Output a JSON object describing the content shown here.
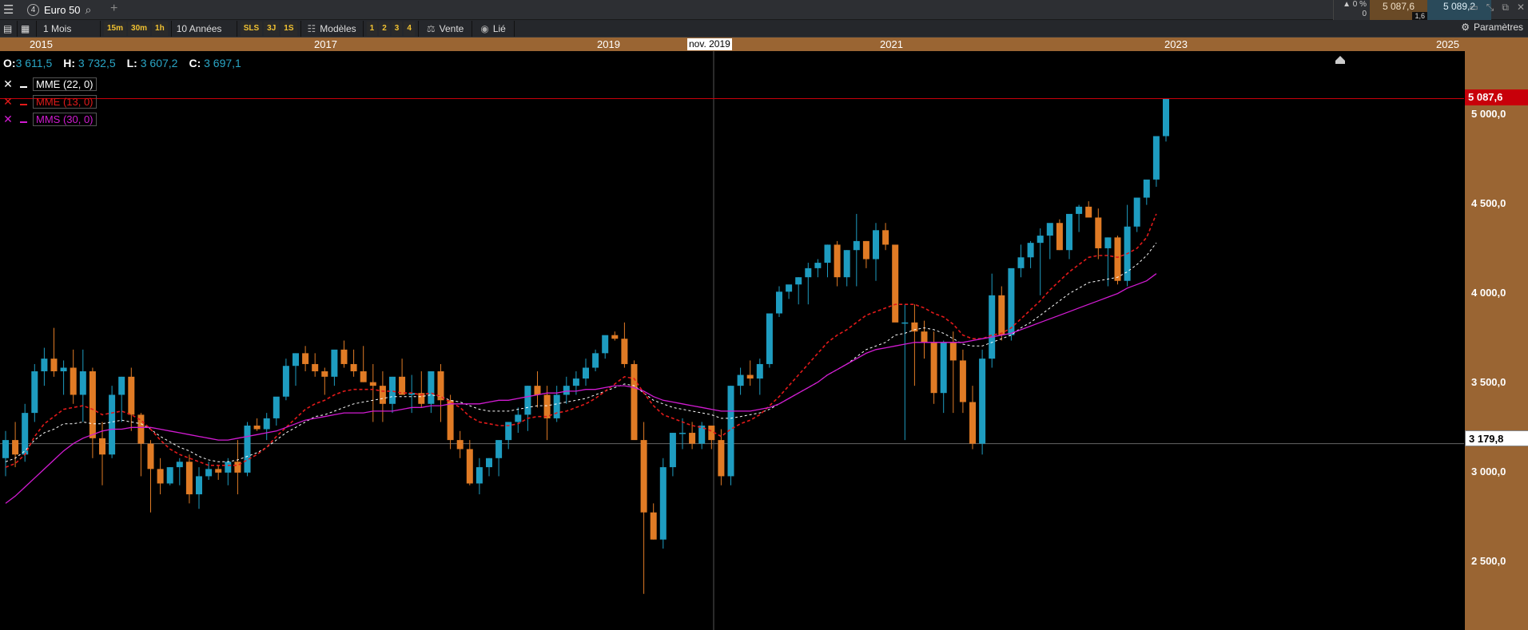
{
  "titlebar": {
    "tab_number": "4",
    "instrument": "Euro 50",
    "change_pct": "0 %",
    "change_val": "0",
    "bid": "5 087,6",
    "ask": "5 089,2",
    "spread": "1,6"
  },
  "toolbar": {
    "period": "1 Mois",
    "intervals": [
      "15m",
      "30m",
      "1h"
    ],
    "range": "10 Années",
    "quick": [
      "SLS",
      "3J",
      "1S"
    ],
    "templates": "Modèles",
    "layouts": [
      "1",
      "2",
      "3",
      "4"
    ],
    "sell": "Vente",
    "linked": "Lié",
    "settings": "Paramètres"
  },
  "datebar": {
    "years": [
      "2015",
      "2017",
      "2019",
      "2021",
      "2023",
      "2025"
    ],
    "cursor_date": "nov. 2019"
  },
  "ohlc": {
    "o_label": "O:",
    "o": "3 611,5",
    "h_label": "H:",
    "h": "3 732,5",
    "l_label": "L:",
    "l": "3 607,2",
    "c_label": "C:",
    "c": "3 697,1"
  },
  "indicators": [
    {
      "name": "MME (22, 0)",
      "color": "#ffffff"
    },
    {
      "name": "MME (13, 0)",
      "color": "#e31a1a"
    },
    {
      "name": "MMS (30, 0)",
      "color": "#d21bd2"
    }
  ],
  "price_axis": {
    "ticks": [
      "5 000,0",
      "4 500,0",
      "4 000,0",
      "3 500,0",
      "3 000,0",
      "2 500,0"
    ],
    "last_price": "5 087,6",
    "cursor_price": "3 179,8"
  },
  "colors": {
    "up": "#1e9cc0",
    "down": "#e07b25",
    "axis_bg": "#9a6533",
    "last_badge": "#c8000a"
  },
  "chart_data": {
    "type": "candlestick",
    "ylim": [
      2150,
      5350
    ],
    "candles": [
      [
        3100,
        3250,
        3000,
        3200
      ],
      [
        3200,
        3300,
        3050,
        3120
      ],
      [
        3120,
        3400,
        3080,
        3350
      ],
      [
        3350,
        3620,
        3300,
        3580
      ],
      [
        3580,
        3710,
        3500,
        3650
      ],
      [
        3650,
        3820,
        3550,
        3580
      ],
      [
        3580,
        3640,
        3450,
        3600
      ],
      [
        3600,
        3700,
        3400,
        3450
      ],
      [
        3450,
        3700,
        3300,
        3580
      ],
      [
        3580,
        3600,
        3100,
        3210
      ],
      [
        3210,
        3300,
        2950,
        3120
      ],
      [
        3120,
        3500,
        3100,
        3450
      ],
      [
        3450,
        3550,
        3300,
        3550
      ],
      [
        3550,
        3600,
        3250,
        3340
      ],
      [
        3340,
        3350,
        3000,
        3180
      ],
      [
        3180,
        3200,
        2800,
        3040
      ],
      [
        3040,
        3100,
        2900,
        2960
      ],
      [
        2960,
        3050,
        2950,
        3050
      ],
      [
        3050,
        3100,
        2950,
        3080
      ],
      [
        3080,
        3120,
        2850,
        2900
      ],
      [
        2900,
        3050,
        2820,
        3000
      ],
      [
        3000,
        3080,
        2980,
        3040
      ],
      [
        3040,
        3060,
        2980,
        3020
      ],
      [
        3020,
        3100,
        2950,
        3080
      ],
      [
        3080,
        3200,
        2900,
        3020
      ],
      [
        3020,
        3300,
        3000,
        3280
      ],
      [
        3280,
        3320,
        3250,
        3260
      ],
      [
        3260,
        3350,
        3200,
        3320
      ],
      [
        3320,
        3400,
        3280,
        3440
      ],
      [
        3440,
        3650,
        3420,
        3610
      ],
      [
        3610,
        3680,
        3500,
        3680
      ],
      [
        3680,
        3720,
        3580,
        3620
      ],
      [
        3620,
        3680,
        3550,
        3580
      ],
      [
        3580,
        3600,
        3450,
        3550
      ],
      [
        3550,
        3680,
        3500,
        3700
      ],
      [
        3700,
        3750,
        3600,
        3620
      ],
      [
        3620,
        3700,
        3550,
        3580
      ],
      [
        3580,
        3720,
        3520,
        3520
      ],
      [
        3520,
        3620,
        3300,
        3500
      ],
      [
        3500,
        3580,
        3300,
        3400
      ],
      [
        3400,
        3550,
        3350,
        3550
      ],
      [
        3550,
        3650,
        3450,
        3450
      ],
      [
        3450,
        3560,
        3350,
        3460
      ],
      [
        3460,
        3580,
        3380,
        3400
      ],
      [
        3400,
        3580,
        3350,
        3580
      ],
      [
        3580,
        3620,
        3300,
        3420
      ],
      [
        3420,
        3450,
        3150,
        3200
      ],
      [
        3200,
        3250,
        3100,
        3150
      ],
      [
        3150,
        3200,
        2950,
        2960
      ],
      [
        2960,
        3100,
        2900,
        3050
      ],
      [
        3050,
        3100,
        3000,
        3100
      ],
      [
        3100,
        3180,
        3000,
        3200
      ],
      [
        3200,
        3300,
        3150,
        3300
      ],
      [
        3300,
        3380,
        3240,
        3340
      ],
      [
        3340,
        3500,
        3250,
        3500
      ],
      [
        3500,
        3580,
        3380,
        3450
      ],
      [
        3450,
        3500,
        3200,
        3320
      ],
      [
        3320,
        3500,
        3300,
        3450
      ],
      [
        3450,
        3550,
        3400,
        3500
      ],
      [
        3500,
        3580,
        3450,
        3540
      ],
      [
        3540,
        3650,
        3500,
        3600
      ],
      [
        3600,
        3700,
        3580,
        3680
      ],
      [
        3680,
        3760,
        3650,
        3780
      ],
      [
        3780,
        3800,
        3750,
        3760
      ],
      [
        3760,
        3850,
        3600,
        3620
      ],
      [
        3620,
        3640,
        3250,
        3200
      ],
      [
        3200,
        3300,
        2350,
        2800
      ],
      [
        2800,
        2850,
        2650,
        2650
      ],
      [
        2650,
        3100,
        2600,
        3050
      ],
      [
        3050,
        3240,
        3000,
        3240
      ],
      [
        3240,
        3320,
        3150,
        3240
      ],
      [
        3240,
        3300,
        3150,
        3180
      ],
      [
        3180,
        3300,
        3150,
        3280
      ],
      [
        3280,
        3250,
        3150,
        3200
      ],
      [
        3200,
        3260,
        2950,
        3000
      ],
      [
        3000,
        3500,
        2950,
        3500
      ],
      [
        3500,
        3600,
        3450,
        3560
      ],
      [
        3560,
        3640,
        3500,
        3540
      ],
      [
        3540,
        3650,
        3450,
        3620
      ],
      [
        3620,
        3900,
        3600,
        3900
      ],
      [
        3900,
        4050,
        3880,
        4020
      ],
      [
        4020,
        4050,
        3980,
        4060
      ],
      [
        4060,
        4100,
        3950,
        4100
      ],
      [
        4100,
        4180,
        3950,
        4150
      ],
      [
        4150,
        4200,
        4100,
        4180
      ],
      [
        4180,
        4280,
        4100,
        4280
      ],
      [
        4280,
        4300,
        4050,
        4100
      ],
      [
        4100,
        4250,
        4050,
        4250
      ],
      [
        4250,
        4450,
        4050,
        4300
      ],
      [
        4300,
        4300,
        4150,
        4200
      ],
      [
        4200,
        4400,
        4080,
        4360
      ],
      [
        4360,
        4400,
        4250,
        4280
      ],
      [
        4280,
        4250,
        4000,
        3850
      ],
      [
        3850,
        3950,
        3200,
        3850
      ],
      [
        3850,
        3950,
        3500,
        3800
      ],
      [
        3800,
        3860,
        3650,
        3740
      ],
      [
        3740,
        3800,
        3400,
        3460
      ],
      [
        3460,
        3750,
        3350,
        3740
      ],
      [
        3740,
        3800,
        3350,
        3640
      ],
      [
        3640,
        3700,
        3350,
        3410
      ],
      [
        3410,
        3500,
        3150,
        3180
      ],
      [
        3180,
        3700,
        3120,
        3650
      ],
      [
        3650,
        4120,
        3600,
        4000
      ],
      [
        4000,
        4050,
        3750,
        3780
      ],
      [
        3780,
        4100,
        3750,
        4150
      ],
      [
        4150,
        4280,
        4100,
        4210
      ],
      [
        4210,
        4300,
        4150,
        4290
      ],
      [
        4290,
        4370,
        4000,
        4330
      ],
      [
        4330,
        4380,
        4200,
        4400
      ],
      [
        4400,
        4420,
        4250,
        4250
      ],
      [
        4250,
        4300,
        4200,
        4450
      ],
      [
        4450,
        4500,
        4350,
        4490
      ],
      [
        4490,
        4520,
        4450,
        4430
      ],
      [
        4430,
        4480,
        4200,
        4260
      ],
      [
        4260,
        4320,
        4050,
        4320
      ],
      [
        4320,
        4330,
        4060,
        4080
      ],
      [
        4080,
        4500,
        4050,
        4380
      ],
      [
        4380,
        4500,
        4350,
        4540
      ],
      [
        4540,
        4580,
        4500,
        4640
      ],
      [
        4640,
        4700,
        4600,
        4880
      ],
      [
        4880,
        4980,
        4850,
        5087.6
      ]
    ],
    "series": [
      {
        "name": "MME (22, 0)",
        "values": [
          3080,
          3100,
          3140,
          3200,
          3240,
          3260,
          3290,
          3290,
          3300,
          3290,
          3290,
          3300,
          3310,
          3300,
          3290,
          3260,
          3220,
          3190,
          3160,
          3140,
          3110,
          3090,
          3080,
          3080,
          3090,
          3110,
          3130,
          3160,
          3200,
          3240,
          3270,
          3300,
          3330,
          3340,
          3360,
          3380,
          3400,
          3410,
          3420,
          3430,
          3440,
          3440,
          3440,
          3440,
          3450,
          3440,
          3420,
          3410,
          3390,
          3370,
          3360,
          3360,
          3360,
          3370,
          3380,
          3390,
          3390,
          3400,
          3410,
          3420,
          3430,
          3450,
          3470,
          3490,
          3510,
          3500,
          3460,
          3420,
          3400,
          3380,
          3370,
          3360,
          3350,
          3340,
          3320,
          3320,
          3330,
          3340,
          3350,
          3370,
          3400,
          3430,
          3460,
          3490,
          3520,
          3560,
          3590,
          3620,
          3660,
          3700,
          3720,
          3740,
          3780,
          3790,
          3810,
          3820,
          3810,
          3790,
          3760,
          3730,
          3720,
          3720,
          3740,
          3760,
          3780,
          3820,
          3850,
          3890,
          3930,
          3970,
          4010,
          4040,
          4070,
          4080,
          4090,
          4100,
          4130,
          4170,
          4220,
          4290
        ]
      },
      {
        "name": "MME (13, 0)",
        "values": [
          3050,
          3070,
          3120,
          3220,
          3290,
          3330,
          3370,
          3380,
          3390,
          3370,
          3340,
          3350,
          3360,
          3340,
          3310,
          3260,
          3200,
          3150,
          3120,
          3100,
          3080,
          3060,
          3060,
          3060,
          3060,
          3090,
          3120,
          3160,
          3220,
          3270,
          3320,
          3370,
          3400,
          3420,
          3450,
          3470,
          3480,
          3480,
          3480,
          3470,
          3470,
          3460,
          3460,
          3450,
          3460,
          3440,
          3410,
          3380,
          3330,
          3300,
          3290,
          3280,
          3280,
          3290,
          3320,
          3330,
          3330,
          3350,
          3360,
          3380,
          3400,
          3430,
          3470,
          3510,
          3550,
          3540,
          3460,
          3390,
          3340,
          3320,
          3300,
          3280,
          3270,
          3250,
          3220,
          3260,
          3290,
          3310,
          3340,
          3390,
          3440,
          3500,
          3560,
          3620,
          3680,
          3740,
          3780,
          3810,
          3850,
          3890,
          3910,
          3930,
          3950,
          3950,
          3950,
          3930,
          3900,
          3880,
          3840,
          3780,
          3760,
          3760,
          3780,
          3790,
          3820,
          3870,
          3920,
          3970,
          4030,
          4080,
          4130,
          4170,
          4210,
          4220,
          4220,
          4210,
          4230,
          4260,
          4320,
          4450
        ]
      },
      {
        "name": "MMS (30, 0)",
        "values": [
          2850,
          2890,
          2940,
          2990,
          3040,
          3090,
          3140,
          3180,
          3210,
          3230,
          3250,
          3260,
          3260,
          3270,
          3270,
          3270,
          3260,
          3250,
          3240,
          3230,
          3220,
          3210,
          3200,
          3200,
          3210,
          3220,
          3230,
          3240,
          3250,
          3270,
          3290,
          3310,
          3320,
          3330,
          3340,
          3350,
          3350,
          3350,
          3360,
          3360,
          3360,
          3370,
          3380,
          3380,
          3390,
          3390,
          3400,
          3400,
          3400,
          3400,
          3410,
          3420,
          3420,
          3430,
          3440,
          3450,
          3460,
          3460,
          3470,
          3470,
          3480,
          3480,
          3490,
          3500,
          3500,
          3490,
          3470,
          3440,
          3420,
          3410,
          3400,
          3390,
          3380,
          3370,
          3360,
          3360,
          3360,
          3360,
          3370,
          3380,
          3400,
          3430,
          3460,
          3490,
          3520,
          3560,
          3590,
          3620,
          3650,
          3680,
          3700,
          3710,
          3720,
          3730,
          3740,
          3740,
          3740,
          3740,
          3740,
          3740,
          3750,
          3760,
          3770,
          3780,
          3790,
          3810,
          3830,
          3850,
          3870,
          3890,
          3910,
          3930,
          3950,
          3970,
          3990,
          4010,
          4040,
          4060,
          4080,
          4120
        ]
      }
    ],
    "last_price": 5087.6,
    "cursor_price": 3179.8
  }
}
